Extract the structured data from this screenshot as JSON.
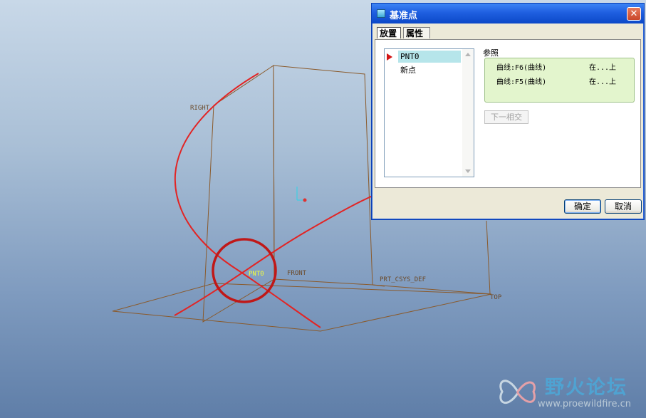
{
  "viewport": {
    "datum_labels": {
      "right": "RIGHT",
      "front": "FRONT",
      "top": "TOP",
      "csys": "PRT_CSYS_DEF",
      "point": "PNT0"
    }
  },
  "dialog": {
    "title": "基准点",
    "close_glyph": "✕",
    "tabs": [
      {
        "label": "放置"
      },
      {
        "label": "属性"
      }
    ],
    "point_list": [
      "PNT0",
      "新点"
    ],
    "references": {
      "label": "参照",
      "rows": [
        {
          "name": "曲线:F6(曲线)",
          "type": "在...上"
        },
        {
          "name": "曲线:F5(曲线)",
          "type": "在...上"
        }
      ]
    },
    "next_intersection_label": "下一相交",
    "ok_label": "确定",
    "cancel_label": "取消"
  },
  "watermark": {
    "title": "野火论坛",
    "url": "www.proewildfire.cn"
  }
}
